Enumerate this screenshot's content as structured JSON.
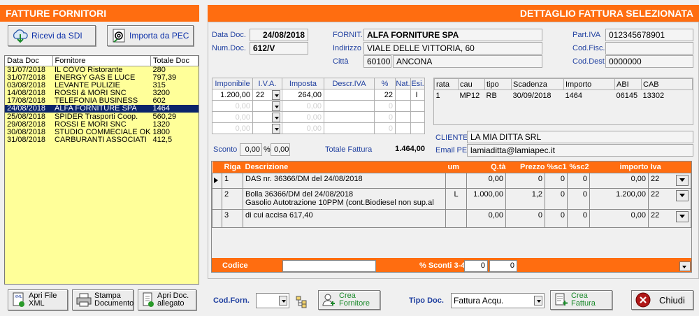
{
  "left_title": "FATTURE FORNITORI",
  "right_title": "DETTAGLIO FATTURA SELEZIONATA",
  "buttons": {
    "ricevi_sdi": "Ricevi da SDI",
    "importa_pec": "Importa da PEC",
    "apri_file": "Apri File XML",
    "stampa": "Stampa Documento",
    "apri_doc": "Apri Doc. allegato",
    "crea_fornitore": "Crea Fornitore",
    "crea_fattura": "Crea Fattura",
    "chiudi": "Chiudi"
  },
  "invoice_list": {
    "headers": [
      "Data Doc",
      "Fornitore",
      "Totale Doc"
    ],
    "rows": [
      [
        "31/07/2018",
        "IL COVO Ristorante",
        "280"
      ],
      [
        "31/07/2018",
        "ENERGY GAS E LUCE",
        "797,39"
      ],
      [
        "03/08/2018",
        "LEVANTE PULIZIE",
        "315"
      ],
      [
        "14/08/2018",
        "ROSSI & MORI SNC",
        "3200"
      ],
      [
        "17/08/2018",
        "TELEFONIA BUSINESS",
        "602"
      ],
      [
        "24/08/2018",
        "ALFA FORNITURE SPA",
        "1464"
      ],
      [
        "25/08/2018",
        "SPIDER Trasporti Coop.",
        "560,29"
      ],
      [
        "29/08/2018",
        "ROSSI E MORI SNC",
        "1320"
      ],
      [
        "30/08/2018",
        "STUDIO COMMECIALE OK",
        "1800"
      ],
      [
        "31/08/2018",
        "CARBURANTI ASSOCIATI",
        "412,5"
      ]
    ],
    "selected_index": 5
  },
  "detail": {
    "data_doc_label": "Data Doc.",
    "data_doc": "24/08/2018",
    "num_doc_label": "Num.Doc.",
    "num_doc": "612/V",
    "fornit_label": "FORNIT.",
    "fornitore": "ALFA FORNITURE SPA",
    "indirizzo_label": "Indirizzo",
    "indirizzo": "VIALE DELLE VITTORIA, 60",
    "citta_label": "Città",
    "cap": "60100",
    "citta": "ANCONA",
    "piva_label": "Part.IVA",
    "piva": "012345678901",
    "codfisc_label": "Cod.Fisc.",
    "codfisc": "",
    "coddest_label": "Cod.Dest.",
    "coddest": "0000000"
  },
  "vat_table": {
    "headers": [
      "Imponibile",
      "I.V.A.",
      "Imposta",
      "Descr.IVA",
      "%",
      "Nat.",
      "Esi."
    ],
    "rows": [
      [
        "1.200,00",
        "22",
        "264,00",
        "",
        "22",
        "",
        "I"
      ],
      [
        "0,00",
        "",
        "0,00",
        "",
        "0",
        "",
        ""
      ],
      [
        "0,00",
        "",
        "0,00",
        "",
        "0",
        "",
        ""
      ],
      [
        "0,00",
        "",
        "0,00",
        "",
        "0",
        "",
        ""
      ]
    ],
    "sconto_label": "Sconto",
    "sconto_value": "0,00",
    "pct_symbol": "%",
    "sconto_pct": "0,00",
    "totale_label": "Totale Fattura",
    "totale": "1.464,00"
  },
  "rate_table": {
    "headers": [
      "rata",
      "cau",
      "tipo",
      "Scadenza",
      "Importo",
      "ABI",
      "CAB"
    ],
    "rows": [
      [
        "1",
        "MP12",
        "RB",
        "30/09/2018",
        "1464",
        "06145",
        "13302"
      ]
    ]
  },
  "cliente": {
    "label": "CLIENTE",
    "value": "LA MIA DITTA SRL",
    "pec_label": "Email PEC",
    "pec": "lamiaditta@lamiapec.it"
  },
  "lines": {
    "headers": [
      "Riga",
      "Descrizione",
      "um",
      "Q.tà",
      "Prezzo",
      "%sc1",
      "%sc2",
      "importo",
      "Iva"
    ],
    "rows": [
      {
        "riga": "1",
        "descr": "DAS nr. 36366/DM  del 24/08/2018",
        "descr2": "",
        "um": "",
        "qta": "0,00",
        "prezzo": "0",
        "sc1": "0",
        "sc2": "0",
        "importo": "0,00",
        "iva": "22"
      },
      {
        "riga": "2",
        "descr": "Bolla 36366/DM del 24/08/2018",
        "descr2": "Gasolio Autotrazione  10PPM (cont.Biodiesel non sup.al",
        "um": "L",
        "qta": "1.000,00",
        "prezzo": "1,2",
        "sc1": "0",
        "sc2": "0",
        "importo": "1.200,00",
        "iva": "22"
      },
      {
        "riga": "3",
        "descr": "di cui accisa 617,40",
        "descr2": "",
        "um": "",
        "qta": "0,00",
        "prezzo": "0",
        "sc1": "0",
        "sc2": "0",
        "importo": "0,00",
        "iva": "22"
      }
    ],
    "codice_label": "Codice",
    "sconti_label": "% Sconti 3-4",
    "sconto3": "0",
    "sconto4": "0"
  },
  "footer": {
    "codforn_label": "Cod.Forn.",
    "tipodoc_label": "Tipo Doc.",
    "tipodoc_value": "Fattura Acqu."
  },
  "colors": {
    "accent": "#ff6d10",
    "list_bg": "#ffff99",
    "selected": "#0a246a",
    "label_blue": "#2040a0"
  }
}
